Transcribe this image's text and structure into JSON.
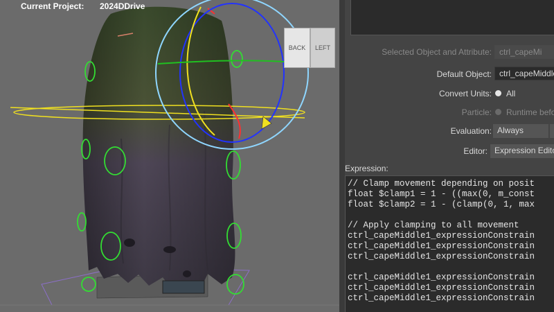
{
  "viewport": {
    "header": {
      "project_label": "Current Project:",
      "project_value": "2024DDrive"
    },
    "viewcube": {
      "face_back": "BACK",
      "face_left": "LEFT"
    }
  },
  "panel": {
    "selected": {
      "label": "Selected Object and Attribute:",
      "value": "ctrl_capeMi"
    },
    "default_object": {
      "label": "Default Object:",
      "value": "ctrl_capeMiddle"
    },
    "convert_units": {
      "label": "Convert Units:",
      "option": "All"
    },
    "particle": {
      "label": "Particle:",
      "option": "Runtime befo"
    },
    "evaluation": {
      "label": "Evaluation:",
      "value": "Always"
    },
    "editor": {
      "label": "Editor:",
      "value": "Expression Edito"
    },
    "expression": {
      "label": "Expression:",
      "lines": [
        "// Clamp movement depending on posit",
        "float $clamp1 = 1 - ((max(0, m_const",
        "float $clamp2 = 1 - (clamp(0, 1, max",
        "",
        "// Apply clamping to all movement",
        "ctrl_capeMiddle1_expressionConstrain",
        "ctrl_capeMiddle1_expressionConstrain",
        "ctrl_capeMiddle1_expressionConstrain",
        "",
        "ctrl_capeMiddle1_expressionConstrain",
        "ctrl_capeMiddle1_expressionConstrain",
        "ctrl_capeMiddle1_expressionConstrain"
      ]
    }
  },
  "colors": {
    "viewport_bg": "#6b6b6b",
    "panel_bg": "#444444",
    "field_bg": "#2b2b2b",
    "cape_dark": "#3f3a44",
    "cape_moss": "#3d4a2e",
    "control_green": "#33dd33",
    "manip_yellow": "#f0e020",
    "manip_blue": "#2233ff",
    "manip_cyan": "#8fd6ff"
  }
}
